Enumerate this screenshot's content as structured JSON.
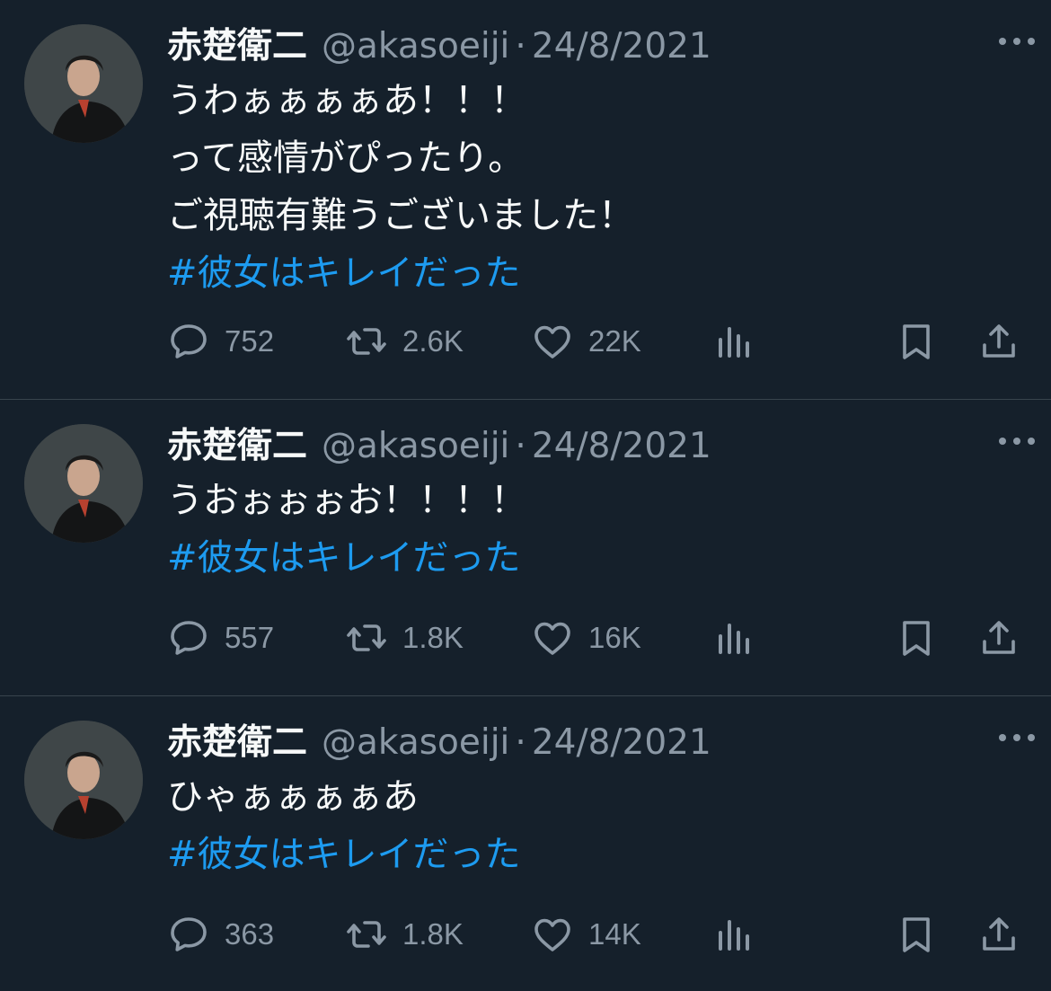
{
  "colors": {
    "background": "#15202b",
    "text": "#f7f9f9",
    "muted": "#8b98a5",
    "link": "#1d9bf0",
    "divider": "#38444d"
  },
  "tweets": [
    {
      "name": "赤楚衛二",
      "handle": "@akasoeiji",
      "separator": "·",
      "date": "24/8/2021",
      "lines": [
        "うわぁぁぁぁあ！！！",
        "って感情がぴったり。",
        "ご視聴有難うございました！"
      ],
      "hashtag": "#彼女はキレイだった",
      "replies": "752",
      "retweets": "2.6K",
      "likes": "22K",
      "icons": {
        "reply": "reply-icon",
        "retweet": "retweet-icon",
        "like": "heart-icon",
        "views": "views-icon",
        "bookmark": "bookmark-icon",
        "share": "share-icon",
        "more": "more-icon"
      }
    },
    {
      "name": "赤楚衛二",
      "handle": "@akasoeiji",
      "separator": "·",
      "date": "24/8/2021",
      "lines": [
        "うおぉぉぉお！！！！"
      ],
      "hashtag": "#彼女はキレイだった",
      "replies": "557",
      "retweets": "1.8K",
      "likes": "16K"
    },
    {
      "name": "赤楚衛二",
      "handle": "@akasoeiji",
      "separator": "·",
      "date": "24/8/2021",
      "lines": [
        "ひゃぁぁぁぁあ"
      ],
      "hashtag": "#彼女はキレイだった",
      "replies": "363",
      "retweets": "1.8K",
      "likes": "14K"
    }
  ]
}
